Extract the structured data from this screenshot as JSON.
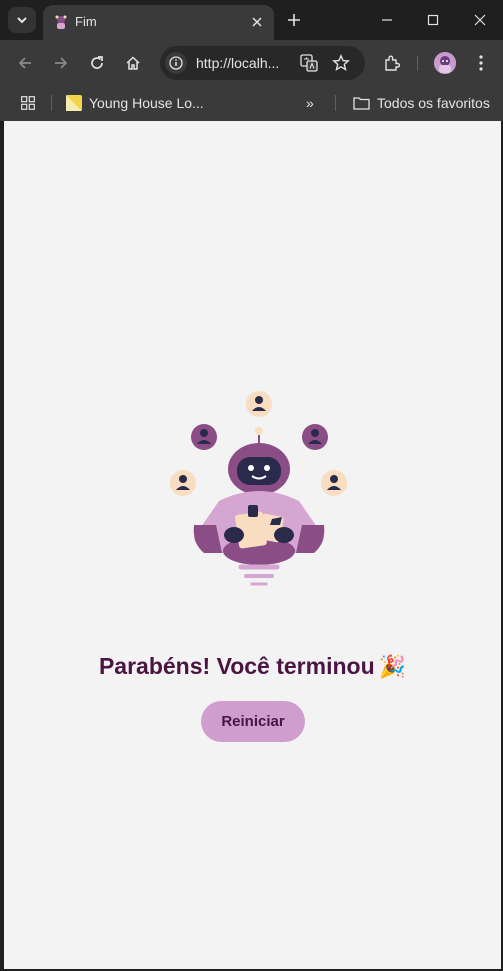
{
  "window": {
    "tab": {
      "title": "Fim",
      "favicon": "mascot-favicon-icon"
    },
    "controls": [
      "minimize-icon",
      "maximize-icon",
      "close-icon"
    ]
  },
  "toolbar": {
    "url": "http://localh...",
    "icons": [
      "back-icon",
      "forward-icon",
      "reload-icon",
      "home-icon",
      "site-info-icon",
      "translate-icon",
      "star-icon",
      "extensions-icon",
      "profile-avatar",
      "menu-icon"
    ]
  },
  "bookmarks": {
    "items": [
      {
        "label": "Young House Lo...",
        "icon": "bookmark-favicon-icon"
      }
    ],
    "overflow": "»",
    "all_bookmarks_label": "Todos os favoritos"
  },
  "page": {
    "heading": "Parabéns! Você terminou",
    "heading_emoji": "🎉",
    "restart_label": "Reiniciar",
    "colors": {
      "background": "#f3f3f3",
      "heading": "#4a1542",
      "button": "#cf9ecf",
      "accent": "#8a4d86",
      "peach": "#f8ddc1"
    }
  }
}
